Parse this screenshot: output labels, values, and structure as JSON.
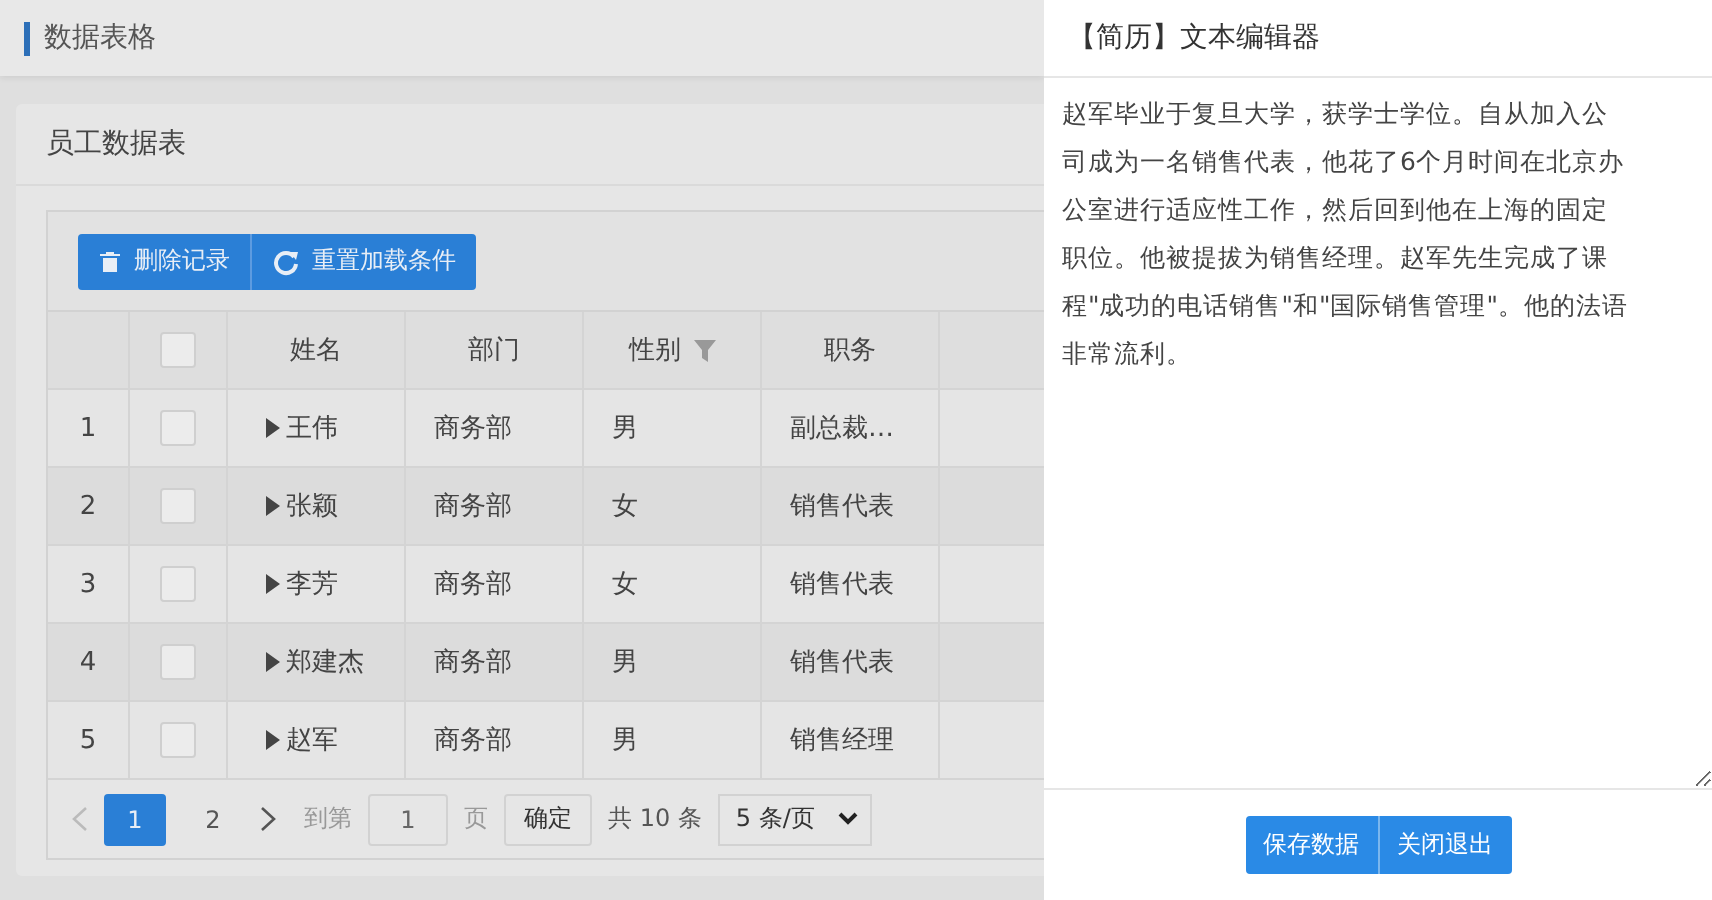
{
  "header": {
    "title": "数据表格"
  },
  "card": {
    "title": "员工数据表"
  },
  "toolbar": [
    {
      "label": "删除记录",
      "kind": "delete"
    },
    {
      "label": "重置加载条件",
      "kind": "reload"
    }
  ],
  "table": {
    "columns": [
      {
        "kind": "index"
      },
      {
        "kind": "check",
        "checked": false
      },
      {
        "label": "姓名",
        "kind": "text"
      },
      {
        "label": "部门",
        "kind": "text"
      },
      {
        "label": "性别",
        "kind": "filter"
      },
      {
        "label": "职务",
        "kind": "text"
      }
    ],
    "rows": [
      {
        "index": "1",
        "checked": false,
        "name": "王伟",
        "dept": "商务部",
        "gender": "男",
        "title": "副总裁…"
      },
      {
        "index": "2",
        "checked": false,
        "name": "张颖",
        "dept": "商务部",
        "gender": "女",
        "title": "销售代表"
      },
      {
        "index": "3",
        "checked": false,
        "name": "李芳",
        "dept": "商务部",
        "gender": "女",
        "title": "销售代表"
      },
      {
        "index": "4",
        "checked": false,
        "name": "郑建杰",
        "dept": "商务部",
        "gender": "男",
        "title": "销售代表"
      },
      {
        "index": "5",
        "checked": false,
        "name": "赵军",
        "dept": "商务部",
        "gender": "男",
        "title": "销售经理"
      }
    ]
  },
  "pagination": {
    "pages": [
      {
        "label": "1",
        "selected": true
      },
      {
        "label": "2",
        "selected": false
      }
    ],
    "goto_label": "到第",
    "goto_value": "1",
    "page_unit": "页",
    "confirm": "确定",
    "total": "共 10 条",
    "page_size": "5 条/页"
  },
  "drawer": {
    "title": "【简历】文本编辑器",
    "text": "赵军毕业于复旦大学，获学士学位。自从加入公司成为一名销售代表，他花了6个月时间在北京办公室进行适应性工作，然后回到他在上海的固定职位。他被提拔为销售经理。赵军先生完成了课程\"成功的电话销售\"和\"国际销售管理\"。他的法语非常流利。",
    "buttons": [
      "保存数据",
      "关闭退出"
    ]
  }
}
